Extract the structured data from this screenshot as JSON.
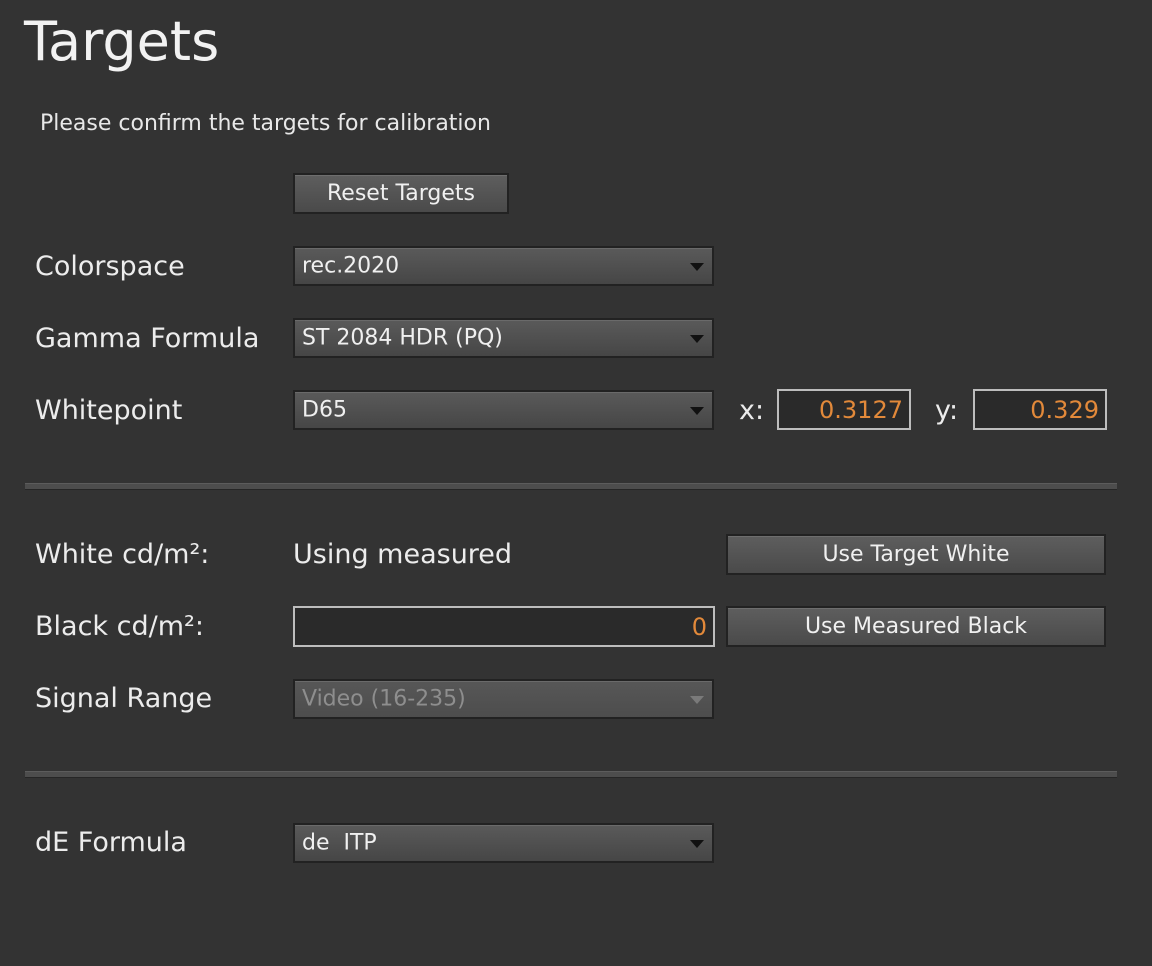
{
  "header": {
    "title": "Targets",
    "subtitle": "Please confirm the targets for calibration"
  },
  "actions": {
    "reset_label": "Reset Targets",
    "use_target_white_label": "Use Target White",
    "use_measured_black_label": "Use Measured Black"
  },
  "colorspace": {
    "label": "Colorspace",
    "value": "rec.2020"
  },
  "gamma": {
    "label": "Gamma Formula",
    "value": "ST 2084 HDR (PQ)"
  },
  "whitepoint": {
    "label": "Whitepoint",
    "value": "D65",
    "x_label": "x:",
    "x_value": "0.3127",
    "y_label": "y:",
    "y_value": "0.329"
  },
  "white": {
    "label": "White cd/m²:",
    "value": "Using measured"
  },
  "black": {
    "label": "Black cd/m²:",
    "value": "0"
  },
  "signal_range": {
    "label": "Signal Range",
    "value": "Video (16-235)",
    "enabled": false
  },
  "de_formula": {
    "label": "dE Formula",
    "value": "de  ITP"
  },
  "colors": {
    "background": "#333333",
    "numeric_text": "#e2893a",
    "text": "#ececec"
  }
}
